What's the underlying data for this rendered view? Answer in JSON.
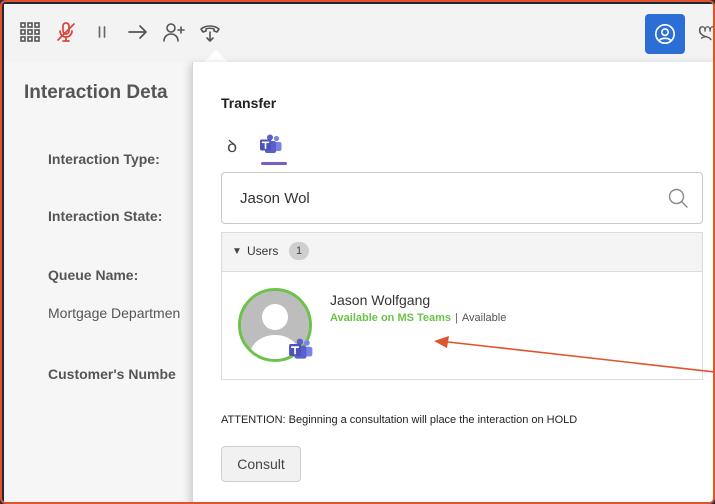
{
  "toolbar": {
    "icons": [
      "grid-apps-icon",
      "mic-off-icon",
      "pause-icon",
      "transfer-arrow-icon",
      "add-user-icon",
      "hangup-icon",
      "agent-icon"
    ],
    "cut_text": "ლ"
  },
  "details": {
    "title": "Interaction Deta",
    "interaction_type_label": "Interaction Type:",
    "interaction_state_label": "Interaction State:",
    "queue_name_label": "Queue Name:",
    "queue_name_value": "Mortgage Departmen",
    "customer_number_label": "Customer's Numbe"
  },
  "transfer": {
    "title": "Transfer",
    "tabs": [
      {
        "icon": "phone-handset-icon",
        "glyph": "ꝺ",
        "active": false
      },
      {
        "icon": "ms-teams-icon",
        "active": true
      }
    ],
    "search_value": "Jason Wol",
    "results": {
      "group_label": "Users",
      "count": "1",
      "users": [
        {
          "name": "Jason Wolfgang",
          "teams_status": "Available on MS Teams",
          "separator": "|",
          "presence": "Available"
        }
      ]
    },
    "attention": "ATTENTION: Beginning a consultation will place the interaction on HOLD",
    "consult_label": "Consult"
  },
  "colors": {
    "frame_border": "#e0542d",
    "accent_blue": "#2b6ed6",
    "teams_purple": "#5b5fc7",
    "available_green": "#6cc24a",
    "annotation_arrow": "#e0542d"
  }
}
